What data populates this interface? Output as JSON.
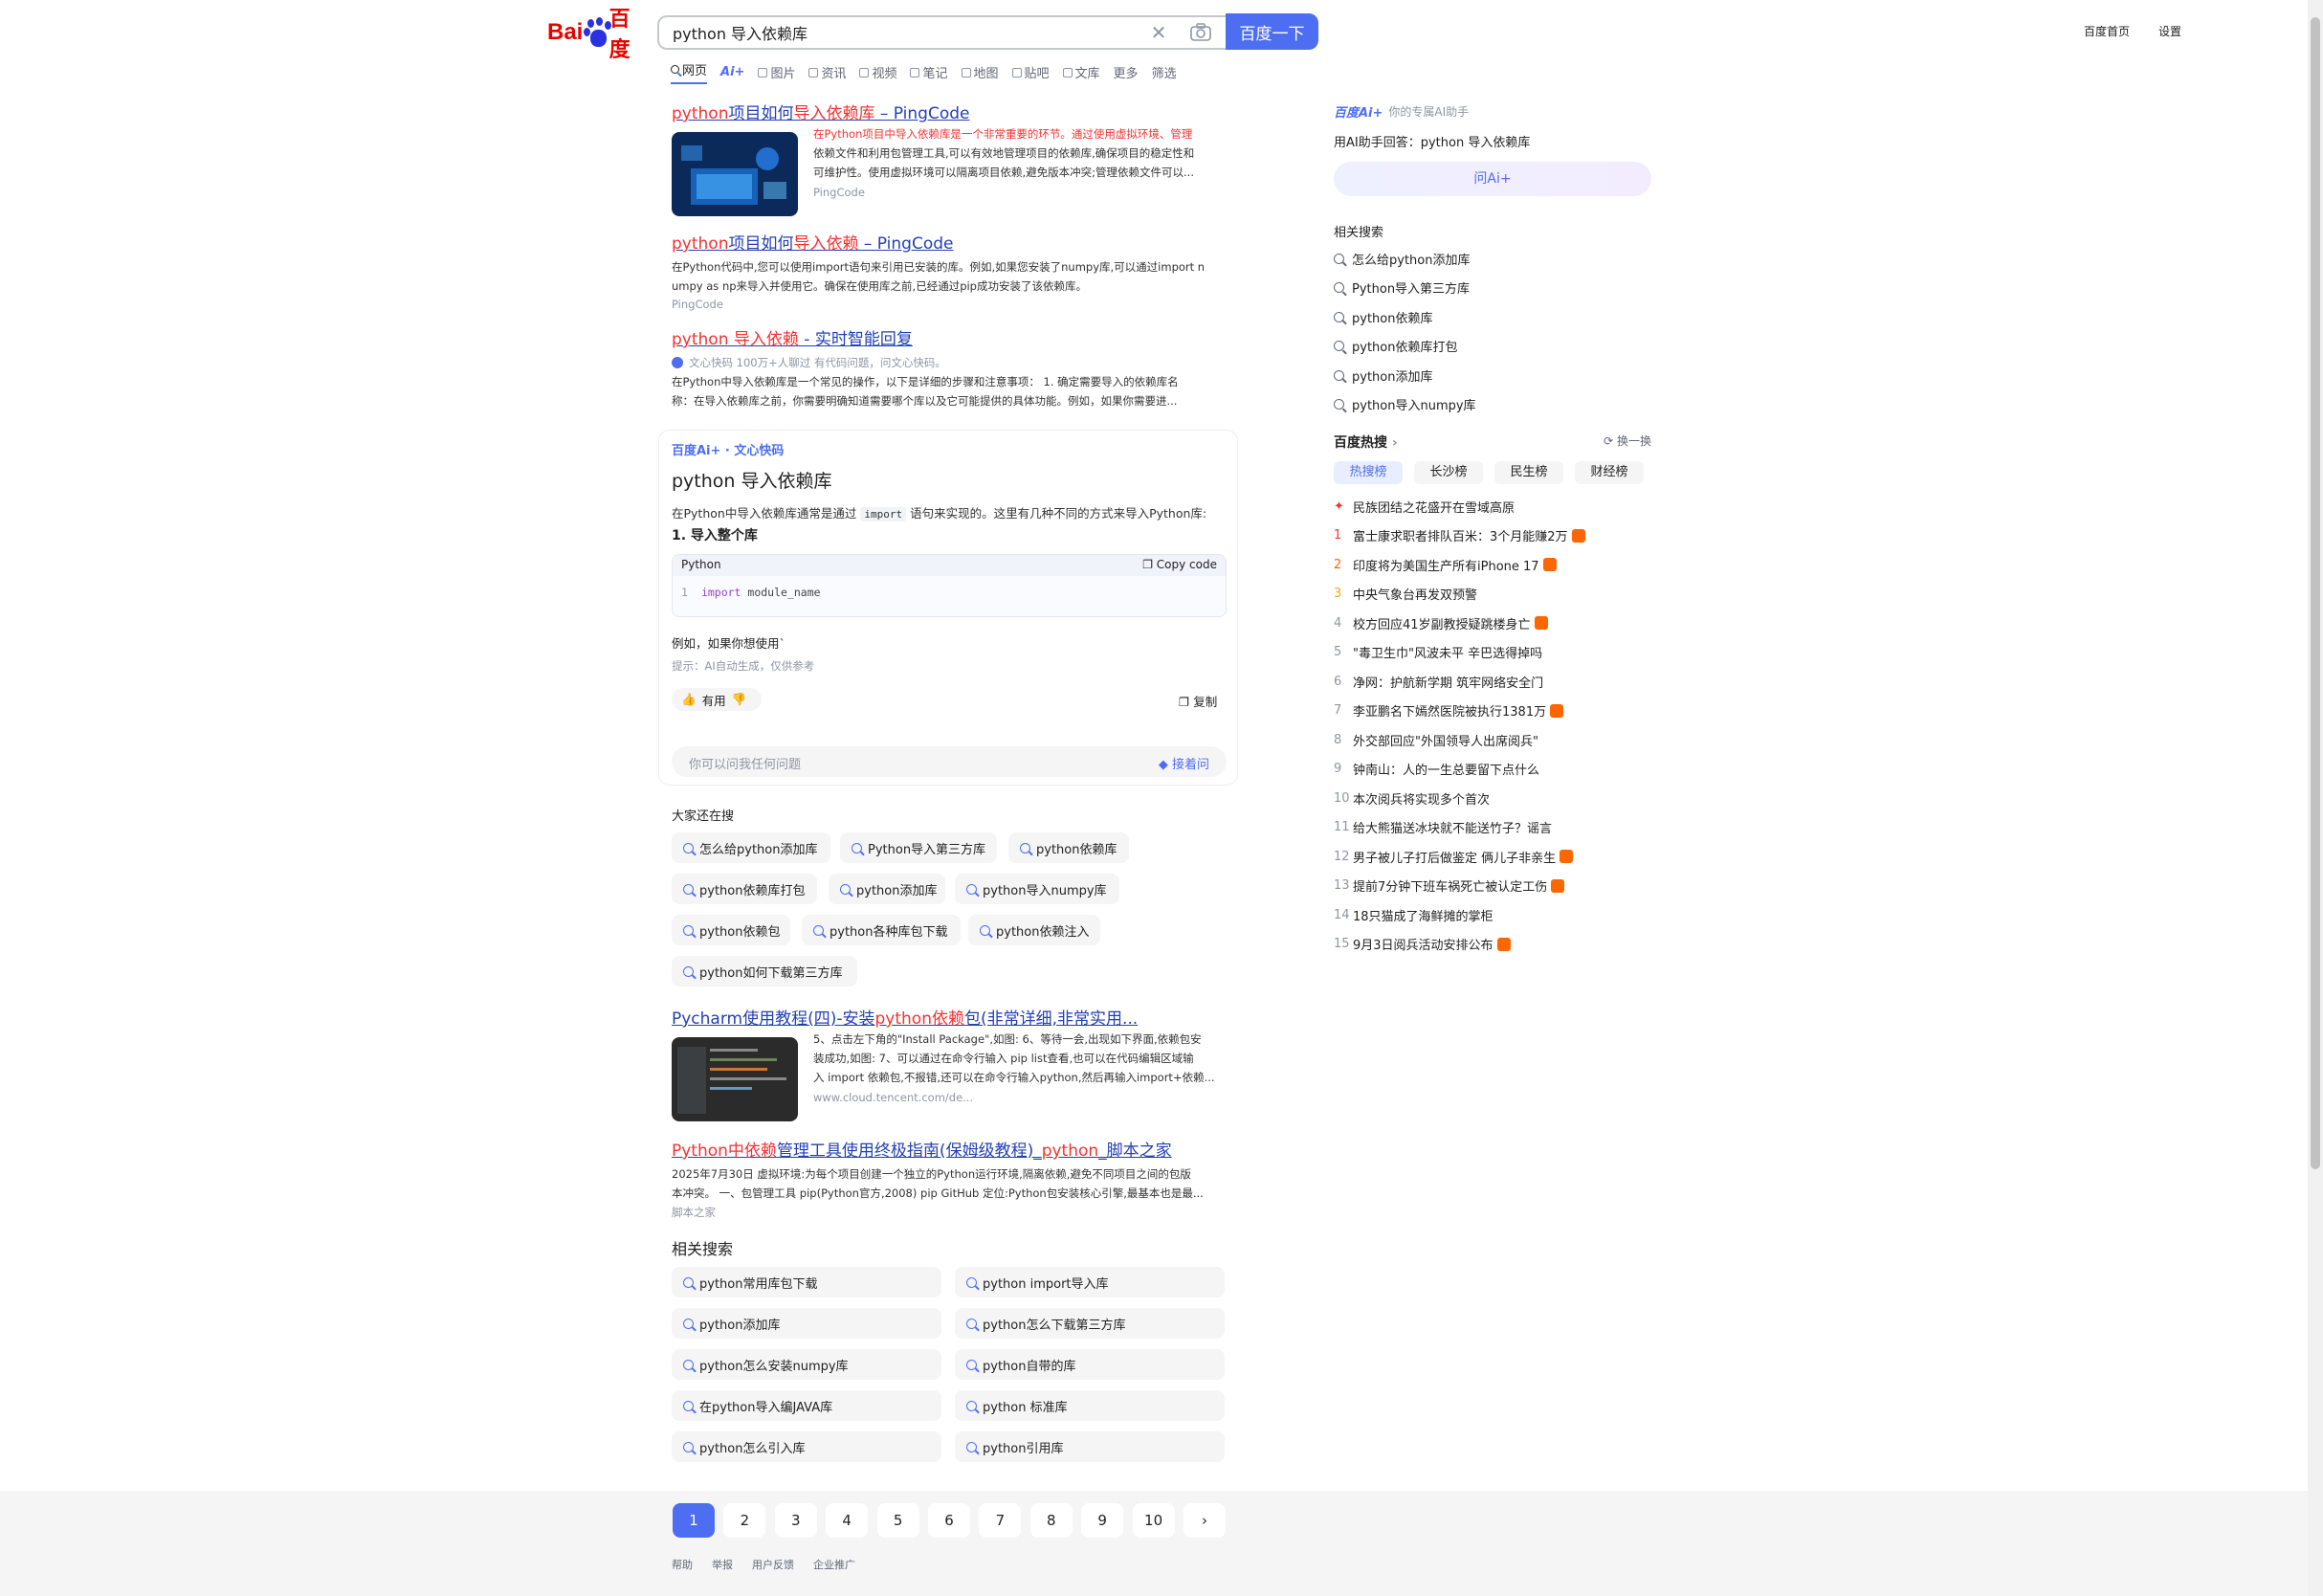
{
  "header": {
    "logo_cn": "百度",
    "search_value": "python 导入依赖库",
    "search_button": "百度一下",
    "links": [
      "百度首页",
      "设置"
    ]
  },
  "tabs": [
    "网页",
    "Ai+",
    "图片",
    "资讯",
    "视频",
    "笔记",
    "地图",
    "贴吧",
    "文库",
    "更多",
    "筛选"
  ],
  "results": [
    {
      "title_parts": [
        {
          "t": "python",
          "h": true
        },
        {
          "t": "项目如何",
          "h": false
        },
        {
          "t": "导入依赖库",
          "h": true
        },
        {
          "t": " – PingCode",
          "h": false
        }
      ],
      "abs_lines": [
        "在Python项目中导入依赖库是一个非常重要的环节。通过使用虚拟环境、管理",
        "依赖文件和利用包管理工具,可以有效地管理项目的依赖库,确保项目的稳定性和",
        "可维护性。使用虚拟环境可以隔离项目依赖,避免版本冲突;管理依赖文件可以..."
      ],
      "source": "PingCode"
    },
    {
      "title_parts": [
        {
          "t": "python",
          "h": true
        },
        {
          "t": "项目如何",
          "h": false
        },
        {
          "t": "导入依赖",
          "h": true
        },
        {
          "t": " – PingCode",
          "h": false
        }
      ],
      "abs_lines": [
        "在Python代码中,您可以使用import语句来引用已安装的库。例如,如果您安装了numpy库,可以通过import n",
        "umpy as np来导入并使用它。确保在使用库之前,已经通过pip成功安装了该依赖库。"
      ],
      "source": "PingCode"
    },
    {
      "title_parts": [
        {
          "t": "python 导入依赖",
          "h": true
        },
        {
          "t": " - 实时智能回复",
          "h": false
        }
      ],
      "meta": "文心快码   100万+人聊过   有代码问题，问文心快码。",
      "abs_lines": [
        "在Python中导入依赖库是一个常见的操作，以下是详细的步骤和注意事项： 1. 确定需要导入的依赖库名",
        "称：在导入依赖库之前，你需要明确知道需要哪个库以及它可能提供的具体功能。例如，如果你需要进..."
      ]
    }
  ],
  "ai": {
    "brand": "百度Ai+ · 文心快码",
    "question": "python 导入依赖库",
    "intro": "在Python中导入依赖库通常是通过",
    "intro_code": "import",
    "intro_end": "语句来实现的。这里有几种不同的方式来导入Python库:",
    "heading": "1. 导入整个库",
    "code_lang": "Python",
    "copy_code": "Copy code",
    "code_line_no": "1",
    "code_kw": "import",
    "code_rest": " module_name",
    "example": "例如，如果你想使用`",
    "tip": "提示：AI自动生成，仅供参考",
    "useful": "有用",
    "copy": "复制",
    "ask_placeholder": "你可以问我任何问题",
    "ask_btn": "接着问"
  },
  "also": {
    "title": "大家还在搜",
    "items": [
      "怎么给python添加库",
      "Python导入第三方库",
      "python依赖库",
      "python依赖库打包",
      "python添加库",
      "python导入numpy库",
      "python依赖包",
      "python各种库包下载",
      "python依赖注入",
      "python如何下载第三方库"
    ]
  },
  "results2": [
    {
      "title_parts": [
        {
          "t": "Pycharm使用教程(四)-安装",
          "h": false
        },
        {
          "t": "python依赖",
          "h": true
        },
        {
          "t": "包(非常详细,非常实用...",
          "h": false
        }
      ],
      "abs_lines": [
        "5、点击左下角的\"Install Package\",如图: 6、等待一会,出现如下界面,依赖包安",
        "装成功,如图: 7、可以通过在命令行输入 pip list查看,也可以在代码编辑区域输",
        "入 import 依赖包,不报错,还可以在命令行输入python,然后再输入import+依赖..."
      ],
      "source": "www.cloud.tencent.com/de..."
    },
    {
      "title_parts": [
        {
          "t": "Python中依赖",
          "h": true
        },
        {
          "t": "管理工具使用终极指南(保姆级教程)_",
          "h": false
        },
        {
          "t": "python",
          "h": true
        },
        {
          "t": "_脚本之家",
          "h": false
        }
      ],
      "abs_lines": [
        "2025年7月30日 虚拟环境:为每个项目创建一个独立的Python运行环境,隔离依赖,避免不同项目之间的包版",
        "本冲突。 一、包管理工具 pip(Python官方,2008) pip GitHub 定位:Python包安装核心引擎,最基本也是最..."
      ],
      "source": "脚本之家"
    }
  ],
  "related": {
    "title": "相关搜索",
    "items": [
      "python常用库包下载",
      "python import导入库",
      "python添加库",
      "python怎么下载第三方库",
      "python怎么安装numpy库",
      "python自带的库",
      "在python导入编JAVA库",
      "python 标准库",
      "python怎么引入库",
      "python引用库"
    ]
  },
  "pagination": [
    "1",
    "2",
    "3",
    "4",
    "5",
    "6",
    "7",
    "8",
    "9",
    "10",
    "›"
  ],
  "footer": [
    "帮助",
    "举报",
    "用户反馈",
    "企业推广"
  ],
  "side": {
    "ai_brand": "百度Ai+",
    "ai_slogan": "你的专属AI助手",
    "ai_answer": "用AI助手回答：python 导入依赖库",
    "ask_btn": "问Ai+",
    "related_title": "相关搜索",
    "related": [
      "怎么给python添加库",
      "Python导入第三方库",
      "python依赖库",
      "python依赖库打包",
      "python添加库",
      "python导入numpy库"
    ],
    "hot_title": "百度热搜",
    "refresh": "换一换",
    "hot_tabs": [
      "热搜榜",
      "长沙榜",
      "民生榜",
      "财经榜"
    ],
    "hot_items": [
      {
        "n": "",
        "t": "民族团结之花盛开在雪域高原",
        "tag": false
      },
      {
        "n": "1",
        "t": "富士康求职者排队百米：3个月能赚2万",
        "tag": true
      },
      {
        "n": "2",
        "t": "印度将为美国生产所有iPhone 17",
        "tag": true
      },
      {
        "n": "3",
        "t": "中央气象台再发双预警",
        "tag": false
      },
      {
        "n": "4",
        "t": "校方回应41岁副教授疑跳楼身亡",
        "tag": true
      },
      {
        "n": "5",
        "t": "\"毒卫生巾\"风波未平 辛巴选得掉吗",
        "tag": false
      },
      {
        "n": "6",
        "t": "净网：护航新学期 筑牢网络安全门",
        "tag": false
      },
      {
        "n": "7",
        "t": "李亚鹏名下嫣然医院被执行1381万",
        "tag": true
      },
      {
        "n": "8",
        "t": "外交部回应\"外国领导人出席阅兵\"",
        "tag": false
      },
      {
        "n": "9",
        "t": "钟南山：人的一生总要留下点什么",
        "tag": false
      },
      {
        "n": "10",
        "t": "本次阅兵将实现多个首次",
        "tag": false
      },
      {
        "n": "11",
        "t": "给大熊猫送冰块就不能送竹子？谣言",
        "tag": false
      },
      {
        "n": "12",
        "t": "男子被儿子打后做鉴定 俩儿子非亲生",
        "tag": true
      },
      {
        "n": "13",
        "t": "提前7分钟下班车祸死亡被认定工伤",
        "tag": true
      },
      {
        "n": "14",
        "t": "18只猫成了海鲜摊的掌柜",
        "tag": false
      },
      {
        "n": "15",
        "t": "9月3日阅兵活动安排公布",
        "tag": true
      }
    ]
  }
}
